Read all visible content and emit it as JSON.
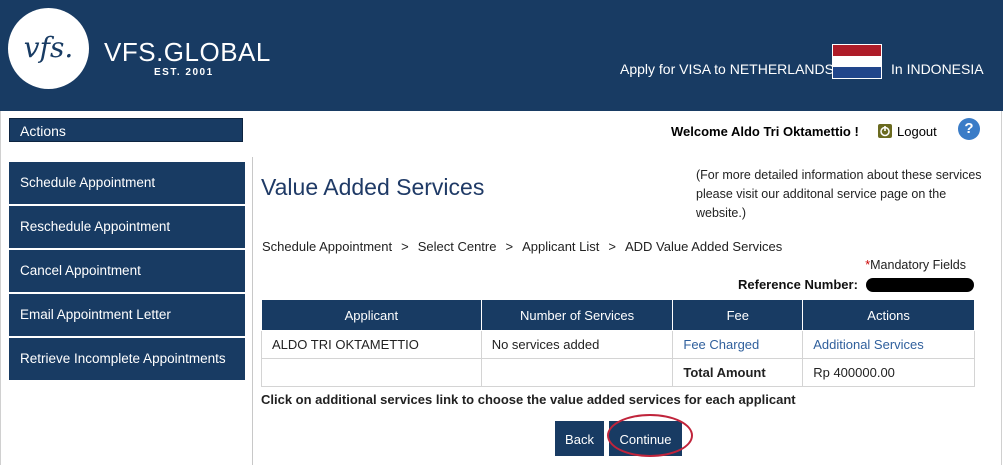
{
  "header": {
    "logo_mark": "vfs.",
    "logo_name": "VFS.GLOBAL",
    "logo_est": "EST. 2001",
    "apply_text": "Apply for VISA to NETHERLANDS",
    "country_text": "In INDONESIA",
    "flag_colors": [
      "#ae1c28",
      "#ffffff",
      "#21468b"
    ]
  },
  "sidebar": {
    "heading": "Actions",
    "items": [
      {
        "label": "Schedule Appointment"
      },
      {
        "label": "Reschedule Appointment"
      },
      {
        "label": "Cancel Appointment"
      },
      {
        "label": "Email Appointment Letter"
      },
      {
        "label": "Retrieve Incomplete Appointments"
      }
    ]
  },
  "user": {
    "welcome": "Welcome Aldo Tri Oktamettio !",
    "logout": "Logout",
    "help": "?"
  },
  "main": {
    "title": "Value Added Services",
    "info": "(For more detailed information about these services please visit our additonal service page on the website.)",
    "breadcrumb": [
      "Schedule Appointment",
      "Select Centre",
      "Applicant List",
      "ADD Value Added Services"
    ],
    "breadcrumb_sep": ">",
    "mandatory_star": "*",
    "mandatory": "Mandatory Fields",
    "reference_label": "Reference Number:",
    "table": {
      "headers": [
        "Applicant",
        "Number of Services",
        "Fee",
        "Actions"
      ],
      "rows": [
        [
          "ALDO TRI OKTAMETTIO",
          "No services added",
          "Fee Charged",
          "Additional Services"
        ],
        [
          "",
          "",
          "Total Amount",
          "Rp 400000.00"
        ]
      ]
    },
    "instruction": "Click on additional services link to choose the value added services for each applicant",
    "back_button": "Back",
    "continue_button": "Continue"
  },
  "colors": {
    "primary": "#183b63",
    "link": "#2f5f9c",
    "highlight": "#c0243b"
  }
}
